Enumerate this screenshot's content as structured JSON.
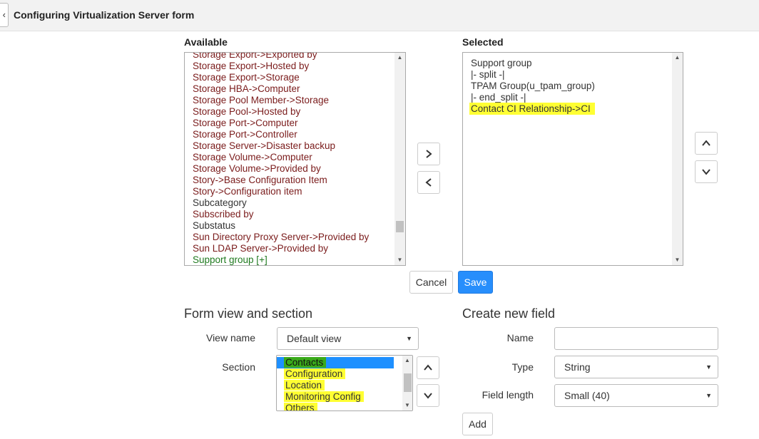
{
  "header": {
    "title": "Configuring Virtualization Server form",
    "back_icon": "chevron-left-icon"
  },
  "available": {
    "label": "Available",
    "items": [
      {
        "text": "Storage Export->Exported by",
        "style": "ref"
      },
      {
        "text": "Storage Export->Hosted by",
        "style": "ref"
      },
      {
        "text": "Storage Export->Storage",
        "style": "ref"
      },
      {
        "text": "Storage HBA->Computer",
        "style": "ref"
      },
      {
        "text": "Storage Pool Member->Storage",
        "style": "ref"
      },
      {
        "text": "Storage Pool->Hosted by",
        "style": "ref"
      },
      {
        "text": "Storage Port->Computer",
        "style": "ref"
      },
      {
        "text": "Storage Port->Controller",
        "style": "ref"
      },
      {
        "text": "Storage Server->Disaster backup",
        "style": "ref"
      },
      {
        "text": "Storage Volume->Computer",
        "style": "ref"
      },
      {
        "text": "Storage Volume->Provided by",
        "style": "ref"
      },
      {
        "text": "Story->Base Configuration Item",
        "style": "ref"
      },
      {
        "text": "Story->Configuration item",
        "style": "ref"
      },
      {
        "text": "Subcategory",
        "style": "plain"
      },
      {
        "text": "Subscribed by",
        "style": "ref"
      },
      {
        "text": "Substatus",
        "style": "plain"
      },
      {
        "text": "Sun Directory Proxy Server->Provided by",
        "style": "ref"
      },
      {
        "text": "Sun LDAP Server->Provided by",
        "style": "ref"
      },
      {
        "text": "Support group [+]",
        "style": "green"
      }
    ]
  },
  "selected": {
    "label": "Selected",
    "items": [
      {
        "text": "Support group",
        "highlight": false
      },
      {
        "text": "|- split -|",
        "highlight": false
      },
      {
        "text": "TPAM Group(u_tpam_group)",
        "highlight": false
      },
      {
        "text": "|- end_split -|",
        "highlight": false
      },
      {
        "text": "Contact CI Relationship->CI",
        "highlight": true
      }
    ]
  },
  "buttons": {
    "cancel": "Cancel",
    "save": "Save",
    "add": "Add"
  },
  "icons": {
    "add": "chevron-right-icon",
    "remove": "chevron-left-icon",
    "up": "chevron-up-icon",
    "down": "chevron-down-icon"
  },
  "form_view": {
    "title": "Form view and section",
    "view_name_label": "View name",
    "view_name_value": "Default view",
    "section_label": "Section",
    "sections": [
      {
        "text": "Contacts",
        "selected": true
      },
      {
        "text": "Configuration",
        "selected": false
      },
      {
        "text": "Location",
        "selected": false
      },
      {
        "text": "Monitoring Config",
        "selected": false
      },
      {
        "text": "Others",
        "selected": false
      }
    ]
  },
  "new_field": {
    "title": "Create new field",
    "name_label": "Name",
    "name_value": "",
    "type_label": "Type",
    "type_value": "String",
    "length_label": "Field length",
    "length_value": "Small (40)"
  },
  "colors": {
    "primary": "#278efc",
    "reference_text": "#7a1b1b",
    "highlight": "#ffff33"
  }
}
